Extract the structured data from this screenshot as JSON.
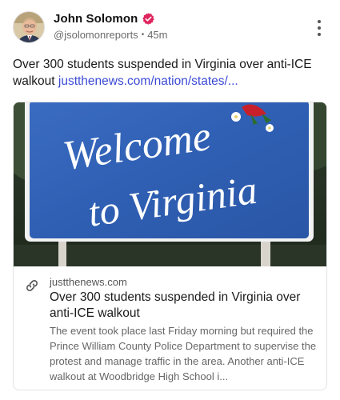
{
  "post": {
    "author_name": "John Solomon",
    "author_handle": "@jsolomonreports",
    "separator": "•",
    "time_ago": "45m",
    "text": "Over 300 students suspended in Virginia over anti-ICE walkout",
    "link_text": "justthenews.com/nation/states/..."
  },
  "link_card": {
    "domain": "justthenews.com",
    "title": "Over 300 students suspended in Virginia over anti-ICE walkout",
    "description": "The event took place last Friday morning but required the Prince William County Police Department to supervise the protest and manage traffic in the area. Another anti-ICE walkout at Woodbridge High School i...",
    "image_sign_text_line1": "Welcome",
    "image_sign_text_line2": "to Virginia"
  },
  "icons": {
    "verified": "verified-badge-icon",
    "more": "more-vertical-icon",
    "link": "link-icon"
  },
  "colors": {
    "verified_badge": "#e0245e",
    "link": "#3b4ad6",
    "sign_blue": "#2f5fb3"
  }
}
